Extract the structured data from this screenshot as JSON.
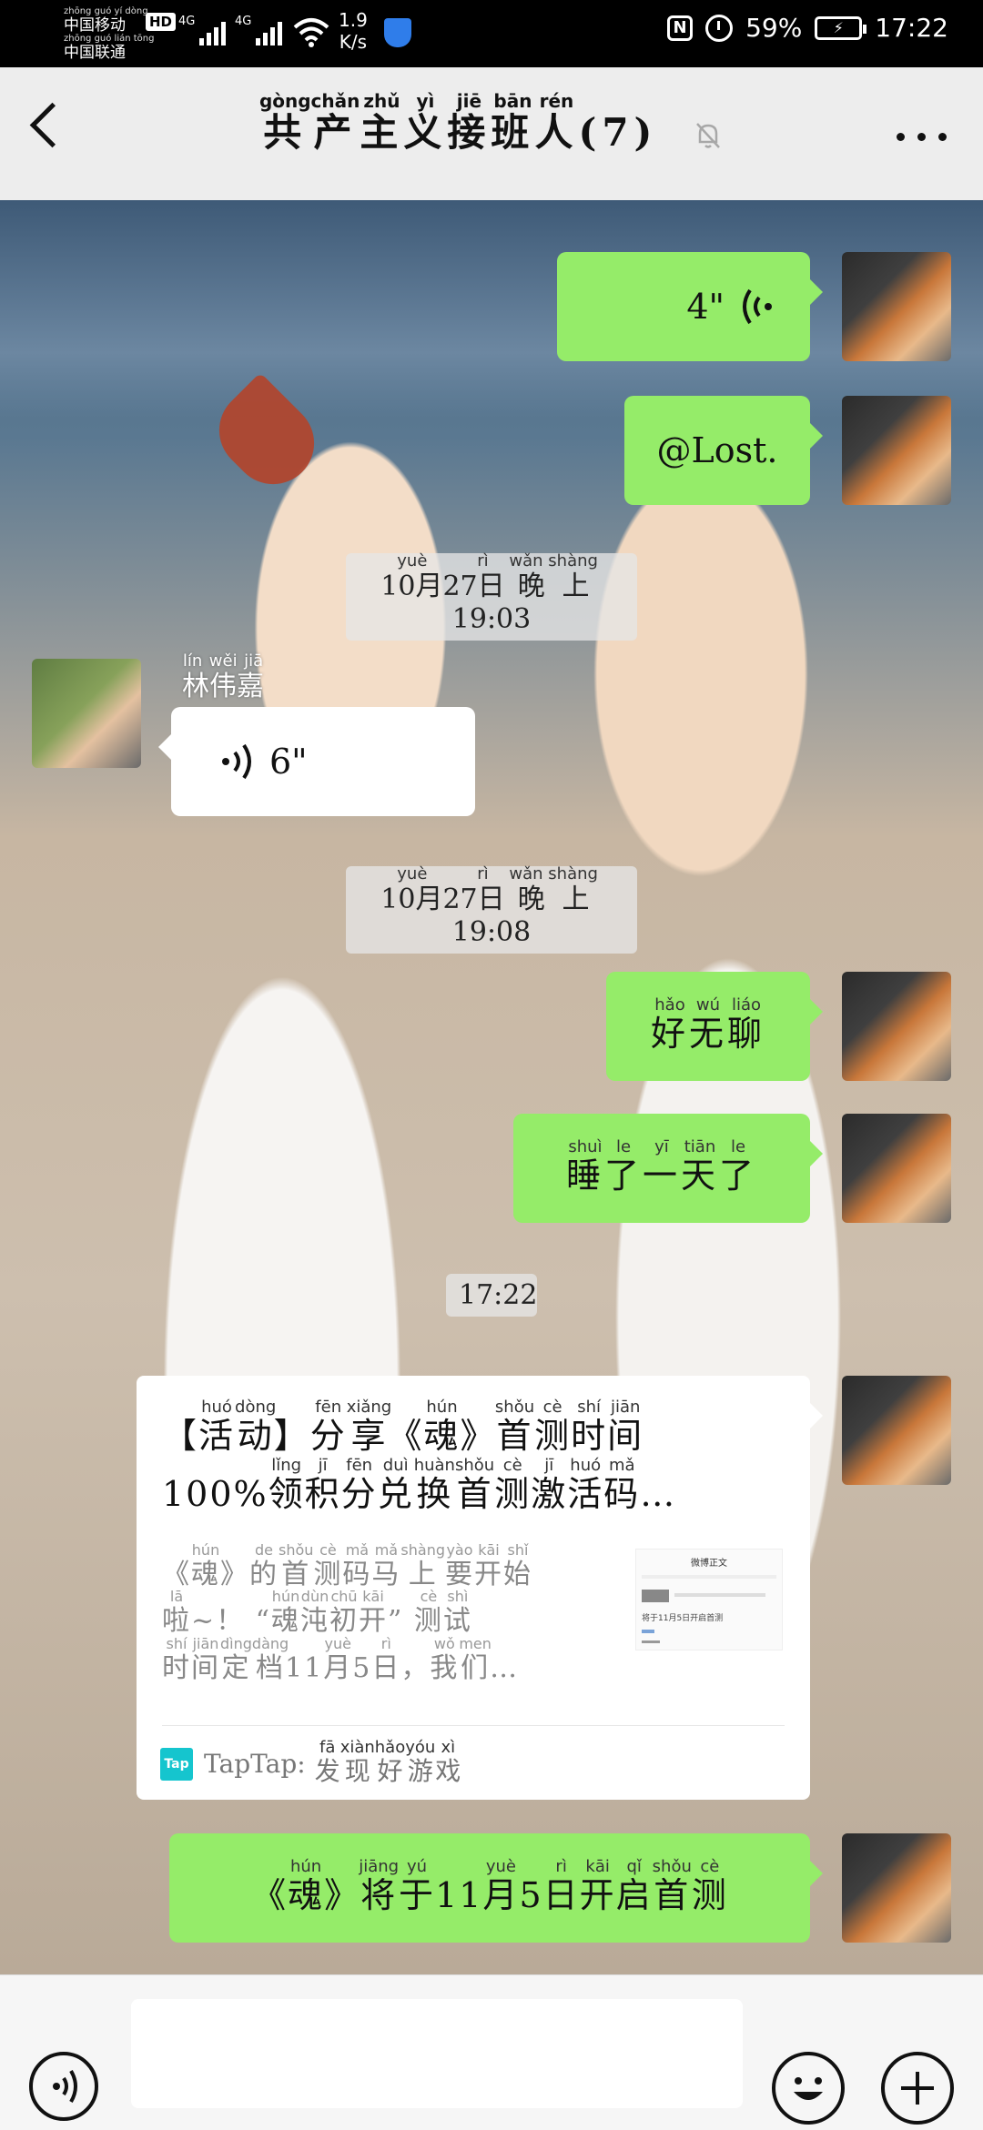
{
  "status_bar": {
    "carrier1": "中国移动",
    "carrier1_pinyin": "zhōng guó yí dòng",
    "carrier2": "中国联通",
    "carrier2_pinyin": "zhōng guó lián tōng",
    "hd": "HD",
    "network1": "4G",
    "network2": "4G",
    "speed_value": "1.9",
    "speed_unit": "K/s",
    "battery": "59%",
    "time": "17:22"
  },
  "header": {
    "title_chars": [
      {
        "c": "共",
        "p": "gòng"
      },
      {
        "c": "产",
        "p": "chǎn"
      },
      {
        "c": "主",
        "p": "zhǔ"
      },
      {
        "c": "义",
        "p": "yì"
      },
      {
        "c": "接",
        "p": "jiē"
      },
      {
        "c": "班",
        "p": "bān"
      },
      {
        "c": "人",
        "p": "rén"
      }
    ],
    "member_count": "(7)",
    "icons": {
      "back": "back-arrow-icon",
      "mute": "mute-bell-icon",
      "more": "more-dots-icon"
    }
  },
  "messages": {
    "m1_duration": "4\"",
    "m2_text": "@Lost.",
    "t1": {
      "date": "10月27日",
      "date_pinyin": "yuè   rì",
      "period": "晚上",
      "period_pinyin": "wǎn shàng",
      "time": "19:03"
    },
    "m3_sender": "林伟嘉",
    "m3_sender_pinyin": "lín wěi jiā",
    "m3_duration": "6\"",
    "t2": {
      "date": "10月27日",
      "date_pinyin": "yuè   rì",
      "period": "晚上",
      "period_pinyin": "wǎn shàng",
      "time": "19:08"
    },
    "m4_chars": [
      {
        "c": "好",
        "p": "hǎo"
      },
      {
        "c": "无",
        "p": "wú"
      },
      {
        "c": "聊",
        "p": "liáo"
      }
    ],
    "m5_chars": [
      {
        "c": "睡",
        "p": "shuì"
      },
      {
        "c": "了",
        "p": "le"
      },
      {
        "c": "一",
        "p": "yī"
      },
      {
        "c": "天",
        "p": "tiān"
      },
      {
        "c": "了",
        "p": "le"
      }
    ],
    "t3": "17:22",
    "card": {
      "title_line1": [
        {
          "c": "【",
          "p": ""
        },
        {
          "c": "活",
          "p": "huó"
        },
        {
          "c": "动",
          "p": "dòng"
        },
        {
          "c": "】",
          "p": ""
        },
        {
          "c": "分",
          "p": "fēn"
        },
        {
          "c": "享",
          "p": "xiǎng"
        },
        {
          "c": "《",
          "p": ""
        },
        {
          "c": "魂",
          "p": "hún"
        },
        {
          "c": "》",
          "p": ""
        },
        {
          "c": "首",
          "p": "shǒu"
        },
        {
          "c": "测",
          "p": "cè"
        },
        {
          "c": "时",
          "p": "shí"
        },
        {
          "c": "间",
          "p": "jiān"
        }
      ],
      "title_line2": [
        {
          "c": "100%",
          "p": ""
        },
        {
          "c": "领",
          "p": "lǐng"
        },
        {
          "c": "积",
          "p": "jī"
        },
        {
          "c": "分",
          "p": "fēn"
        },
        {
          "c": "兑",
          "p": "duì"
        },
        {
          "c": "换",
          "p": "huàn"
        },
        {
          "c": "首",
          "p": "shǒu"
        },
        {
          "c": "测",
          "p": "cè"
        },
        {
          "c": "激",
          "p": "jī"
        },
        {
          "c": "活",
          "p": "huó"
        },
        {
          "c": "码",
          "p": "mǎ"
        },
        {
          "c": "…",
          "p": ""
        }
      ],
      "desc_line1": [
        {
          "c": "《",
          "p": ""
        },
        {
          "c": "魂",
          "p": "hún"
        },
        {
          "c": "》",
          "p": ""
        },
        {
          "c": "的",
          "p": "de"
        },
        {
          "c": "首",
          "p": "shǒu"
        },
        {
          "c": "测",
          "p": "cè"
        },
        {
          "c": "码",
          "p": "mǎ"
        },
        {
          "c": "马",
          "p": "mǎ"
        },
        {
          "c": "上",
          "p": "shàng"
        },
        {
          "c": "要",
          "p": "yào"
        },
        {
          "c": "开",
          "p": "kāi"
        },
        {
          "c": "始",
          "p": "shǐ"
        }
      ],
      "desc_line2": [
        {
          "c": "啦",
          "p": "lā"
        },
        {
          "c": "~！ “",
          "p": ""
        },
        {
          "c": "魂",
          "p": "hún"
        },
        {
          "c": "沌",
          "p": "dùn"
        },
        {
          "c": "初",
          "p": "chū"
        },
        {
          "c": "开",
          "p": "kāi"
        },
        {
          "c": "” ",
          "p": ""
        },
        {
          "c": "测",
          "p": "cè"
        },
        {
          "c": "试",
          "p": "shì"
        }
      ],
      "desc_line3": [
        {
          "c": "时",
          "p": "shí"
        },
        {
          "c": "间",
          "p": "jiān"
        },
        {
          "c": "定",
          "p": "dìng"
        },
        {
          "c": "档",
          "p": "dàng"
        },
        {
          "c": "11",
          "p": ""
        },
        {
          "c": "月",
          "p": "yuè"
        },
        {
          "c": "5",
          "p": ""
        },
        {
          "c": "日",
          "p": "rì"
        },
        {
          "c": "，",
          "p": ""
        },
        {
          "c": "我",
          "p": "wǒ"
        },
        {
          "c": "们",
          "p": "men"
        },
        {
          "c": "…",
          "p": ""
        }
      ],
      "thumb_title": "微博正文",
      "thumb_text": "将于11月5日开启首测",
      "source_logo": "Tap",
      "source_name": "TapTap:",
      "source_tag": [
        {
          "c": "发",
          "p": "fā"
        },
        {
          "c": "现",
          "p": "xiàn"
        },
        {
          "c": "好",
          "p": "hǎo"
        },
        {
          "c": "游",
          "p": "yóu"
        },
        {
          "c": "戏",
          "p": "xì"
        }
      ]
    },
    "m6_chars": [
      {
        "c": "《",
        "p": ""
      },
      {
        "c": "魂",
        "p": "hún"
      },
      {
        "c": "》",
        "p": ""
      },
      {
        "c": "将",
        "p": "jiāng"
      },
      {
        "c": "于",
        "p": "yú"
      },
      {
        "c": "11",
        "p": ""
      },
      {
        "c": "月",
        "p": "yuè"
      },
      {
        "c": "5",
        "p": ""
      },
      {
        "c": "日",
        "p": "rì"
      },
      {
        "c": "开",
        "p": "kāi"
      },
      {
        "c": "启",
        "p": "qǐ"
      },
      {
        "c": "首",
        "p": "shǒu"
      },
      {
        "c": "测",
        "p": "cè"
      }
    ]
  },
  "input_bar": {
    "icons": {
      "voice": "voice-toggle-icon",
      "emoji": "emoji-icon",
      "plus": "plus-icon"
    }
  },
  "colors": {
    "bubble_green": "#95ec69",
    "header_bg": "#ededed"
  }
}
